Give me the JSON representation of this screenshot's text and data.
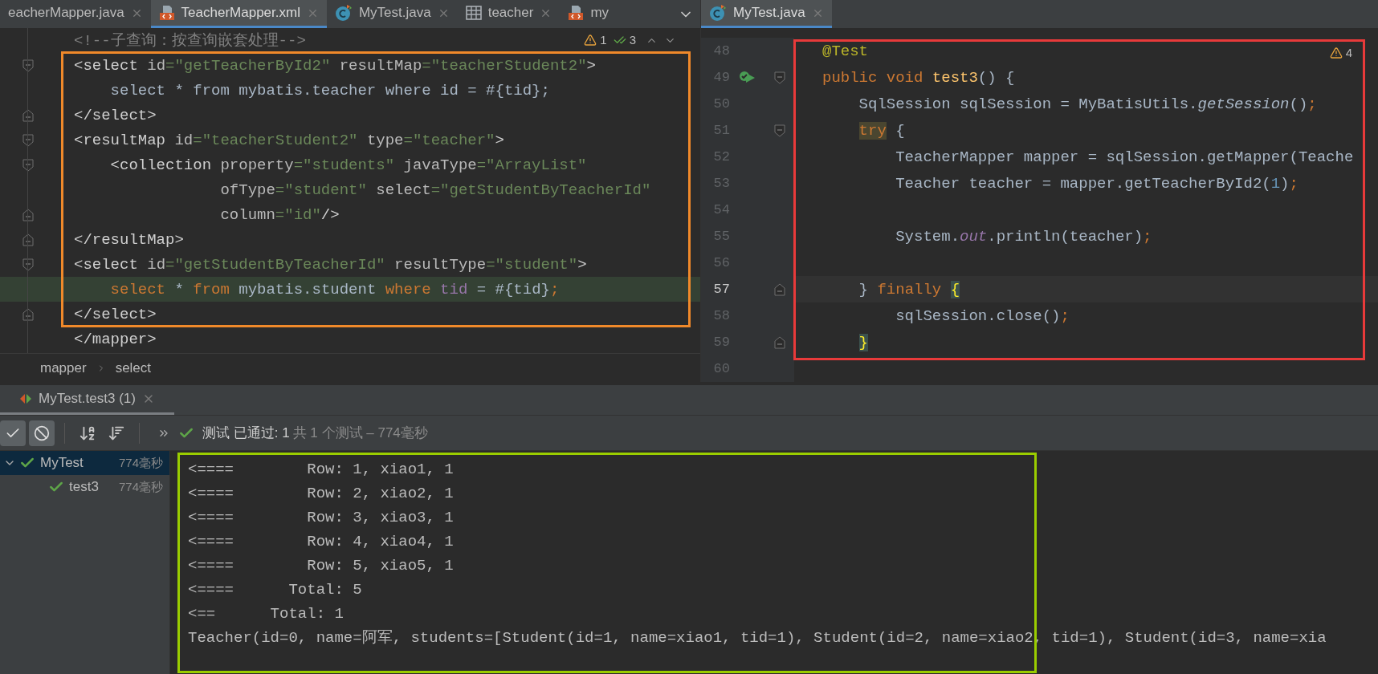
{
  "left_tabs": [
    {
      "label": "eacherMapper.java",
      "kind": "plain",
      "selected": false,
      "closable": true
    },
    {
      "label": "TeacherMapper.xml",
      "kind": "xml",
      "selected": true,
      "closable": true
    },
    {
      "label": "MyTest.java",
      "kind": "class",
      "selected": false,
      "closable": true
    },
    {
      "label": "teacher",
      "kind": "table",
      "selected": false,
      "closable": true
    },
    {
      "label": "my",
      "kind": "xml",
      "selected": false,
      "closable": false
    }
  ],
  "left_editor": {
    "warnings": "1",
    "checks": "3",
    "lines": [
      {
        "kind": "code",
        "highlighted": false,
        "tokens": [
          {
            "text": "<!--子查询：按查询嵌套处理-->",
            "kind": "comment"
          }
        ]
      },
      {
        "kind": "fold_start",
        "highlighted": false,
        "tokens": [
          {
            "text": "<select",
            "kind": "tag"
          },
          {
            "text": " id",
            "kind": "attr"
          },
          {
            "text": "=\"getTeacherById2\"",
            "kind": "str"
          },
          {
            "text": " resultMap",
            "kind": "attr"
          },
          {
            "text": "=\"teacherStudent2\"",
            "kind": "str"
          },
          {
            "text": ">",
            "kind": "tag"
          }
        ]
      },
      {
        "kind": "code",
        "highlighted": false,
        "tokens": [
          {
            "text": "    select * from mybatis.teacher where id = #{tid};",
            "kind": "plain"
          }
        ]
      },
      {
        "kind": "fold_end",
        "highlighted": false,
        "tokens": [
          {
            "text": "</select>",
            "kind": "tag"
          }
        ]
      },
      {
        "kind": "fold_start",
        "highlighted": false,
        "tokens": [
          {
            "text": "<resultMap",
            "kind": "tag"
          },
          {
            "text": " id",
            "kind": "attr"
          },
          {
            "text": "=\"teacherStudent2\"",
            "kind": "str"
          },
          {
            "text": " type",
            "kind": "attr"
          },
          {
            "text": "=\"teacher\"",
            "kind": "str"
          },
          {
            "text": ">",
            "kind": "tag"
          }
        ]
      },
      {
        "kind": "fold_start",
        "highlighted": false,
        "tokens": [
          {
            "text": "    <collection",
            "kind": "tag"
          },
          {
            "text": " property",
            "kind": "attr"
          },
          {
            "text": "=\"students\"",
            "kind": "str"
          },
          {
            "text": " javaType",
            "kind": "attr"
          },
          {
            "text": "=\"ArrayList\"",
            "kind": "str"
          }
        ]
      },
      {
        "kind": "code",
        "highlighted": false,
        "tokens": [
          {
            "text": "                ofType",
            "kind": "attr"
          },
          {
            "text": "=\"student\"",
            "kind": "str"
          },
          {
            "text": " select",
            "kind": "attr"
          },
          {
            "text": "=\"getStudentByTeacherId\"",
            "kind": "str"
          }
        ]
      },
      {
        "kind": "fold_end",
        "highlighted": false,
        "tokens": [
          {
            "text": "                column",
            "kind": "attr"
          },
          {
            "text": "=\"id\"",
            "kind": "str"
          },
          {
            "text": "/>",
            "kind": "tag"
          }
        ]
      },
      {
        "kind": "fold_end",
        "highlighted": false,
        "tokens": [
          {
            "text": "</resultMap>",
            "kind": "tag"
          }
        ]
      },
      {
        "kind": "fold_start",
        "highlighted": false,
        "tokens": [
          {
            "text": "<select",
            "kind": "tag"
          },
          {
            "text": " id",
            "kind": "attr"
          },
          {
            "text": "=\"getStudentByTeacherId\"",
            "kind": "str"
          },
          {
            "text": " resultType",
            "kind": "attr"
          },
          {
            "text": "=\"student\"",
            "kind": "str"
          },
          {
            "text": ">",
            "kind": "tag"
          }
        ]
      },
      {
        "kind": "code",
        "highlighted": true,
        "tokens": [
          {
            "text": "    select",
            "kind": "kw"
          },
          {
            "text": " * ",
            "kind": "plain"
          },
          {
            "text": "from",
            "kind": "kw"
          },
          {
            "text": " mybatis.student ",
            "kind": "plain"
          },
          {
            "text": "where",
            "kind": "kw"
          },
          {
            "text": " tid",
            "kind": "field"
          },
          {
            "text": " = #{tid}",
            "kind": "plain"
          },
          {
            "text": ";",
            "kind": "kw"
          }
        ]
      },
      {
        "kind": "fold_end",
        "highlighted": false,
        "tokens": [
          {
            "text": "</select>",
            "kind": "tag"
          }
        ]
      },
      {
        "kind": "code",
        "highlighted": false,
        "tokens": [
          {
            "text": "</mapper>",
            "kind": "tag"
          }
        ]
      }
    ]
  },
  "breadcrumbs": [
    "mapper",
    "select"
  ],
  "right_tabs": [
    {
      "label": "MyTest.java",
      "kind": "class",
      "selected": true,
      "closable": true
    }
  ],
  "right_editor": {
    "warnings": "4",
    "lines": [
      {
        "number": "48",
        "kind": "code",
        "current": false,
        "run_marker": false,
        "tokens": [
          {
            "text": "@Test",
            "kind": "annot"
          }
        ]
      },
      {
        "number": "49",
        "kind": "fold_start",
        "current": false,
        "run_marker": true,
        "tokens": [
          {
            "text": "public void ",
            "kind": "kw"
          },
          {
            "text": "test3",
            "kind": "method"
          },
          {
            "text": "() {",
            "kind": "plain"
          }
        ]
      },
      {
        "number": "50",
        "kind": "code",
        "current": false,
        "run_marker": false,
        "tokens": [
          {
            "text": "    SqlSession sqlSession = MyBatisUtils.",
            "kind": "plain"
          },
          {
            "text": "getSession",
            "kind": "italic"
          },
          {
            "text": "()",
            "kind": "plain"
          },
          {
            "text": ";",
            "kind": "kw"
          }
        ]
      },
      {
        "number": "51",
        "kind": "fold_start",
        "current": false,
        "run_marker": false,
        "tokens": [
          {
            "text": "    try",
            "kind": "kw_match"
          },
          {
            "text": " {",
            "kind": "plain"
          }
        ]
      },
      {
        "number": "52",
        "kind": "code",
        "current": false,
        "run_marker": false,
        "tokens": [
          {
            "text": "        TeacherMapper mapper = sqlSession.getMapper(Teache",
            "kind": "plain"
          }
        ]
      },
      {
        "number": "53",
        "kind": "code",
        "current": false,
        "run_marker": false,
        "tokens": [
          {
            "text": "        Teacher teacher = mapper.getTeacherById2(",
            "kind": "plain"
          },
          {
            "text": "1",
            "kind": "num"
          },
          {
            "text": ")",
            "kind": "plain"
          },
          {
            "text": ";",
            "kind": "kw"
          }
        ]
      },
      {
        "number": "54",
        "kind": "code",
        "current": false,
        "run_marker": false
      },
      {
        "number": "55",
        "kind": "code",
        "current": false,
        "run_marker": false,
        "tokens": [
          {
            "text": "        System.",
            "kind": "plain"
          },
          {
            "text": "out",
            "kind": "static_field"
          },
          {
            "text": ".println(teacher)",
            "kind": "plain"
          },
          {
            "text": ";",
            "kind": "kw"
          }
        ]
      },
      {
        "number": "56",
        "kind": "code",
        "current": false,
        "run_marker": false
      },
      {
        "number": "57",
        "kind": "fold_end",
        "current": true,
        "run_marker": false,
        "tokens": [
          {
            "text": "    } ",
            "kind": "plain"
          },
          {
            "text": "finally ",
            "kind": "kw"
          },
          {
            "text": "{",
            "kind": "brace_match"
          }
        ]
      },
      {
        "number": "58",
        "kind": "code",
        "current": false,
        "run_marker": false,
        "tokens": [
          {
            "text": "        sqlSession.close()",
            "kind": "plain"
          },
          {
            "text": ";",
            "kind": "kw"
          }
        ]
      },
      {
        "number": "59",
        "kind": "fold_end",
        "current": false,
        "run_marker": false,
        "tokens": [
          {
            "text": "    }",
            "kind": "brace_match"
          }
        ]
      },
      {
        "number": "60",
        "kind": "code",
        "current": false,
        "run_marker": false
      }
    ]
  },
  "run_panel": {
    "tab": {
      "label": "MyTest.test3 (1)",
      "selected": true
    },
    "toggles": [
      {
        "kind": "passed",
        "selected": true
      },
      {
        "kind": "ignored",
        "selected": true
      }
    ],
    "sorts": [
      {
        "kind": "alpha"
      },
      {
        "kind": "duration"
      }
    ],
    "status_passed": "测试 已通过: 1",
    "status_summary": "共 1 个测试 – 774毫秒",
    "tree": [
      {
        "name": "MyTest",
        "time": "774毫秒",
        "selected": true,
        "expanded": true,
        "passed": true,
        "children": [
          {
            "name": "test3",
            "time": "774毫秒",
            "selected": false,
            "passed": true
          }
        ]
      }
    ],
    "console": [
      "<====        Row: 1, xiao1, 1",
      "<====        Row: 2, xiao2, 1",
      "<====        Row: 3, xiao3, 1",
      "<====        Row: 4, xiao4, 1",
      "<====        Row: 5, xiao5, 1",
      "<====      Total: 5",
      "<==      Total: 1",
      "Teacher(id=0, name=阿军, students=[Student(id=1, name=xiao1, tid=1), Student(id=2, name=xiao2, tid=1), Student(id=3, name=xia"
    ]
  }
}
